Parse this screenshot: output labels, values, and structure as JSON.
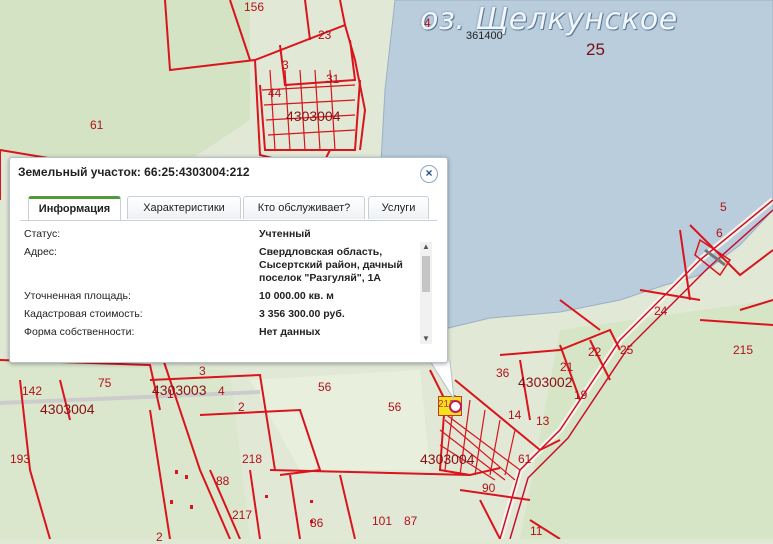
{
  "map": {
    "lake_title": "оз. Щелкунское",
    "lake_code": "361400",
    "lake_number": "25",
    "labels": [
      {
        "text": "156"
      },
      {
        "text": "4"
      },
      {
        "text": "23"
      },
      {
        "text": "3"
      },
      {
        "text": "31"
      },
      {
        "text": "44"
      },
      {
        "text": "4303004"
      },
      {
        "text": "61"
      },
      {
        "text": "5"
      },
      {
        "text": "6"
      },
      {
        "text": "24"
      },
      {
        "text": "25"
      },
      {
        "text": "22"
      },
      {
        "text": "21"
      },
      {
        "text": "215"
      },
      {
        "text": "36"
      },
      {
        "text": "4303002"
      },
      {
        "text": "19"
      },
      {
        "text": "13"
      },
      {
        "text": "14"
      },
      {
        "text": "56"
      },
      {
        "text": "56"
      },
      {
        "text": "4303003"
      },
      {
        "text": "3"
      },
      {
        "text": "4"
      },
      {
        "text": "2"
      },
      {
        "text": "142"
      },
      {
        "text": "4303004"
      },
      {
        "text": "75"
      },
      {
        "text": "193"
      },
      {
        "text": "218"
      },
      {
        "text": "88"
      },
      {
        "text": "217"
      },
      {
        "text": "86"
      },
      {
        "text": "101"
      },
      {
        "text": "87"
      },
      {
        "text": "4303004"
      },
      {
        "text": "61"
      },
      {
        "text": "90"
      },
      {
        "text": "11"
      },
      {
        "text": "1"
      },
      {
        "text": "2"
      }
    ]
  },
  "popup": {
    "title": "Земельный участок: 66:25:4303004:212",
    "tabs": [
      {
        "label": "Информация"
      },
      {
        "label": "Характеристики"
      },
      {
        "label": "Кто обслуживает?"
      },
      {
        "label": "Услуги"
      }
    ],
    "rows": [
      {
        "key": "Статус:",
        "value": "Учтенный"
      },
      {
        "key": "Адрес:",
        "value": "Свердловская область, Сысертский район, дачный поселок \"Разгуляй\", 1А"
      },
      {
        "key": "Уточненная площадь:",
        "value": "10 000.00 кв. м"
      },
      {
        "key": "Кадастровая стоимость:",
        "value": "3 356 300.00 руб."
      },
      {
        "key": "Форма собственности:",
        "value": "Нет данных"
      }
    ]
  },
  "marker": {
    "label": "212"
  },
  "colors": {
    "boundary": "#d9141c",
    "lake": "#b9cddc",
    "land": "#dfe8d2",
    "tab_active": "#4f9a3b"
  }
}
